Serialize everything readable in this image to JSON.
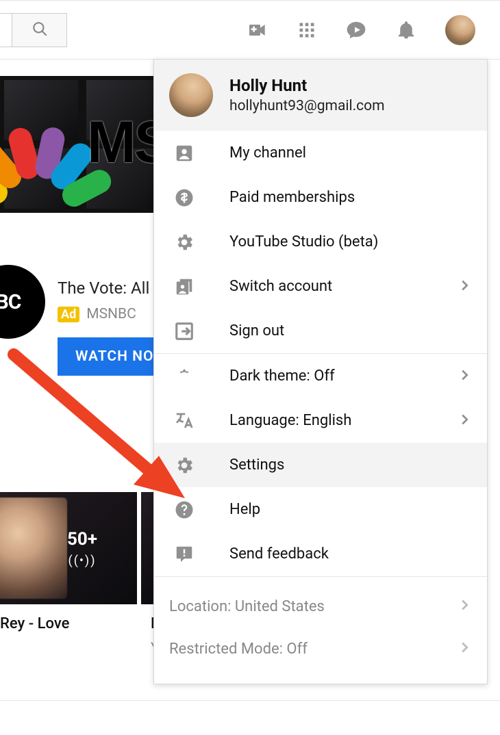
{
  "topbar": {
    "icons": {
      "search": "search-icon",
      "create": "video-plus-icon",
      "apps": "grid-apps-icon",
      "messages": "chat-bubble-icon",
      "notifications": "bell-icon",
      "avatar": "user-avatar"
    }
  },
  "background": {
    "banner_text": "MS",
    "channel_badge": "BC",
    "ad": {
      "title": "The Vote: All I",
      "badge": "Ad",
      "advertiser": "MSNBC",
      "cta": "WATCH NO"
    },
    "thumb_overlay": {
      "count": "50+",
      "broadcast_glyph": "((•))"
    },
    "thumb2_label": "M",
    "videos": [
      {
        "title": "Rey - Love",
        "subtitle": ""
      },
      {
        "title": "M",
        "subtitle": "Yo"
      }
    ]
  },
  "menu": {
    "user": {
      "name": "Holly Hunt",
      "email": "hollyhunt93@gmail.com"
    },
    "items": [
      {
        "icon": "person-box-icon",
        "label": "My channel",
        "chevron": false
      },
      {
        "icon": "dollar-circle-icon",
        "label": "Paid memberships",
        "chevron": false
      },
      {
        "icon": "gear-icon",
        "label": "YouTube Studio (beta)",
        "chevron": false
      },
      {
        "icon": "switch-account-icon",
        "label": "Switch account",
        "chevron": true
      },
      {
        "icon": "sign-out-icon",
        "label": "Sign out",
        "chevron": false
      }
    ],
    "prefs": [
      {
        "icon": "moon-icon",
        "label": "Dark theme: Off",
        "chevron": true
      },
      {
        "icon": "translate-icon",
        "label": "Language: English",
        "chevron": true
      },
      {
        "icon": "settings-gear-icon",
        "label": "Settings",
        "chevron": false,
        "highlight": true
      },
      {
        "icon": "help-icon",
        "label": "Help",
        "chevron": false
      },
      {
        "icon": "feedback-icon",
        "label": "Send feedback",
        "chevron": false
      }
    ],
    "footer": [
      {
        "label": "Location: United States",
        "chevron": true
      },
      {
        "label": "Restricted Mode: Off",
        "chevron": true
      }
    ]
  },
  "annotation": {
    "target": "Settings"
  }
}
